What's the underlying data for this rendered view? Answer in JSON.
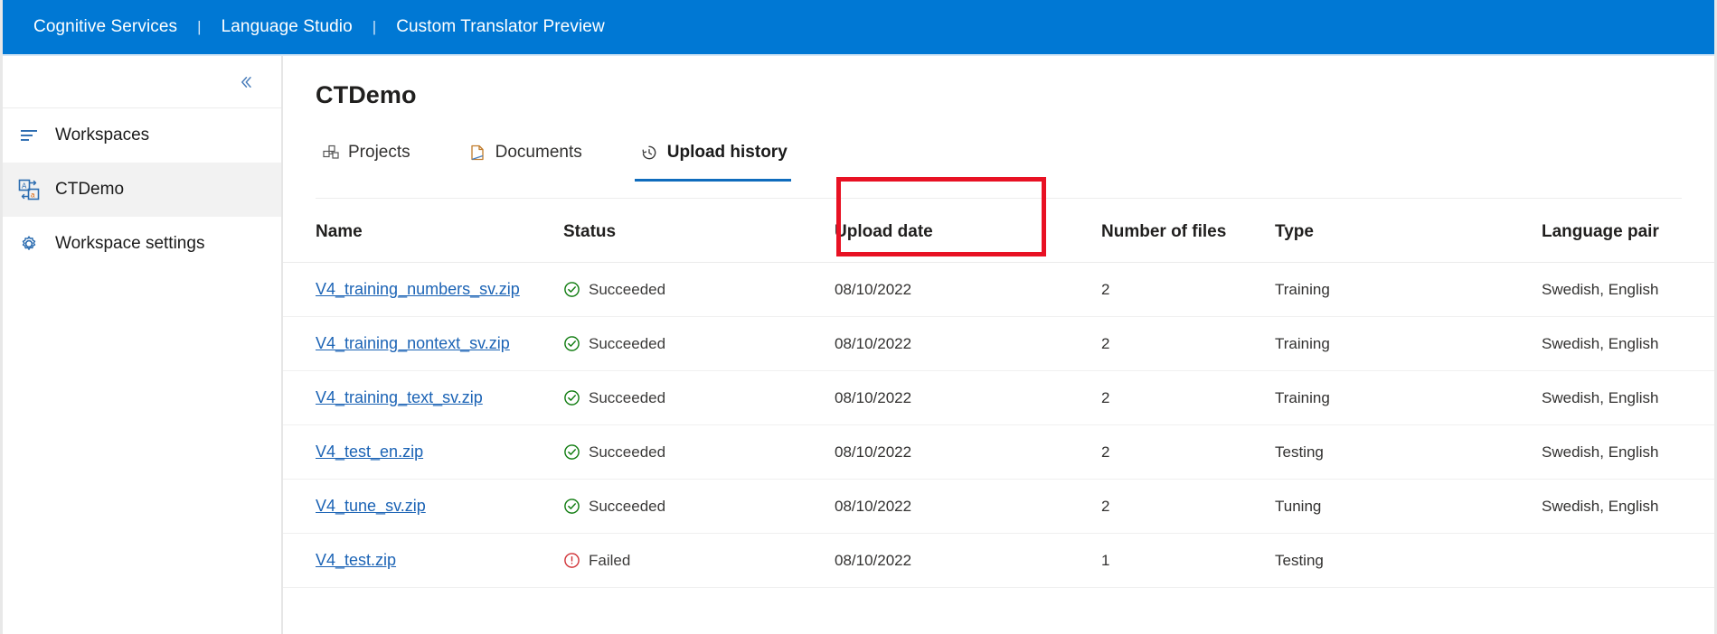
{
  "topbar": {
    "links": [
      {
        "label": "Cognitive Services",
        "name": "cognitive-services"
      },
      {
        "label": "Language Studio",
        "name": "language-studio"
      },
      {
        "label": "Custom Translator Preview",
        "name": "custom-translator-preview"
      }
    ],
    "separator": "|",
    "background_color": "#0078d4"
  },
  "sidebar": {
    "collapse_icon": "chevron-double-left-icon",
    "items": [
      {
        "label": "Workspaces",
        "icon": "list-lines-icon",
        "selected": false
      },
      {
        "label": "CTDemo",
        "icon": "translate-icon",
        "selected": true
      },
      {
        "label": "Workspace settings",
        "icon": "gear-icon",
        "selected": false
      }
    ]
  },
  "main": {
    "page_title": "CTDemo",
    "tabs": [
      {
        "label": "Projects",
        "icon": "cubes-icon",
        "active": false
      },
      {
        "label": "Documents",
        "icon": "document-icon",
        "active": false
      },
      {
        "label": "Upload history",
        "icon": "history-clock-icon",
        "active": true
      }
    ],
    "highlight_color": "#e81123",
    "active_tab_underline_color": "#0f6cbd"
  },
  "table": {
    "columns": [
      "Name",
      "Status",
      "Upload date",
      "Number of files",
      "Type",
      "Language pair"
    ],
    "status_colors": {
      "succeeded": "#107c10",
      "failed": "#d13438"
    },
    "rows": [
      {
        "name": "V4_training_numbers_sv.zip",
        "status": "Succeeded",
        "status_icon": "check-circle-icon",
        "upload_date": "08/10/2022",
        "number_of_files": "2",
        "type": "Training",
        "language_pair": "Swedish, English"
      },
      {
        "name": "V4_training_nontext_sv.zip",
        "status": "Succeeded",
        "status_icon": "check-circle-icon",
        "upload_date": "08/10/2022",
        "number_of_files": "2",
        "type": "Training",
        "language_pair": "Swedish, English"
      },
      {
        "name": "V4_training_text_sv.zip",
        "status": "Succeeded",
        "status_icon": "check-circle-icon",
        "upload_date": "08/10/2022",
        "number_of_files": "2",
        "type": "Training",
        "language_pair": "Swedish, English"
      },
      {
        "name": "V4_test_en.zip",
        "status": "Succeeded",
        "status_icon": "check-circle-icon",
        "upload_date": "08/10/2022",
        "number_of_files": "2",
        "type": "Testing",
        "language_pair": "Swedish, English"
      },
      {
        "name": "V4_tune_sv.zip",
        "status": "Succeeded",
        "status_icon": "check-circle-icon",
        "upload_date": "08/10/2022",
        "number_of_files": "2",
        "type": "Tuning",
        "language_pair": "Swedish, English"
      },
      {
        "name": "V4_test.zip",
        "status": "Failed",
        "status_icon": "error-circle-icon",
        "upload_date": "08/10/2022",
        "number_of_files": "1",
        "type": "Testing",
        "language_pair": ""
      }
    ]
  }
}
